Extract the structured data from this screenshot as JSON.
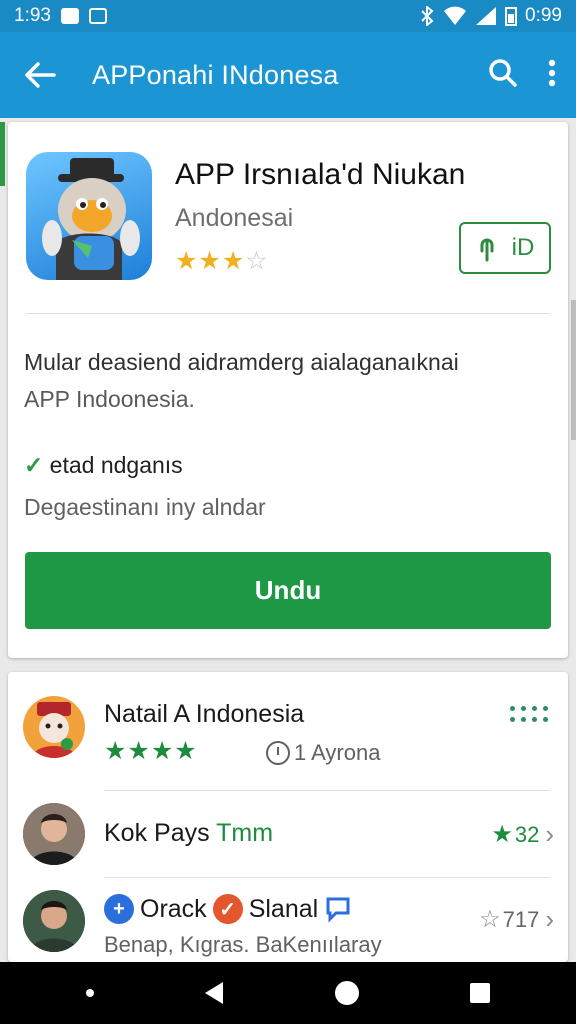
{
  "status_bar": {
    "time": "1:93",
    "battery": "0:99"
  },
  "app_bar": {
    "title": "APPonahi INdonesa"
  },
  "app": {
    "name": "APP Irsnıala'd Niukan",
    "developer": "Andonesai",
    "rating_stars": 3,
    "share_label": "iD"
  },
  "description": {
    "line1": "Mular deasiend aidramderg aialaganaıknai",
    "line2": "APP Indoonesia."
  },
  "feature": {
    "check": "✓",
    "label": "etad ndganıs"
  },
  "note": "Degaestinanı iny alndar",
  "install_label": "Undu",
  "list": [
    {
      "title": "Natail A Indonesia",
      "stars": "★★★★",
      "meta": "1 Ayrona"
    },
    {
      "title_a": "Kok Pays ",
      "title_b": "Tmm",
      "rating": "32",
      "chevron": "›"
    },
    {
      "title_a": "Orack",
      "title_b": "Slanal",
      "subtitle": "Benap, Kıgras. BaKenıılaray",
      "rating": "717",
      "chevron": "›"
    }
  ],
  "colors": {
    "appbar": "#1b95d3",
    "status_bar": "#1a8ac4",
    "primary_green": "#1f9846",
    "star_gold": "#f2b01e"
  }
}
